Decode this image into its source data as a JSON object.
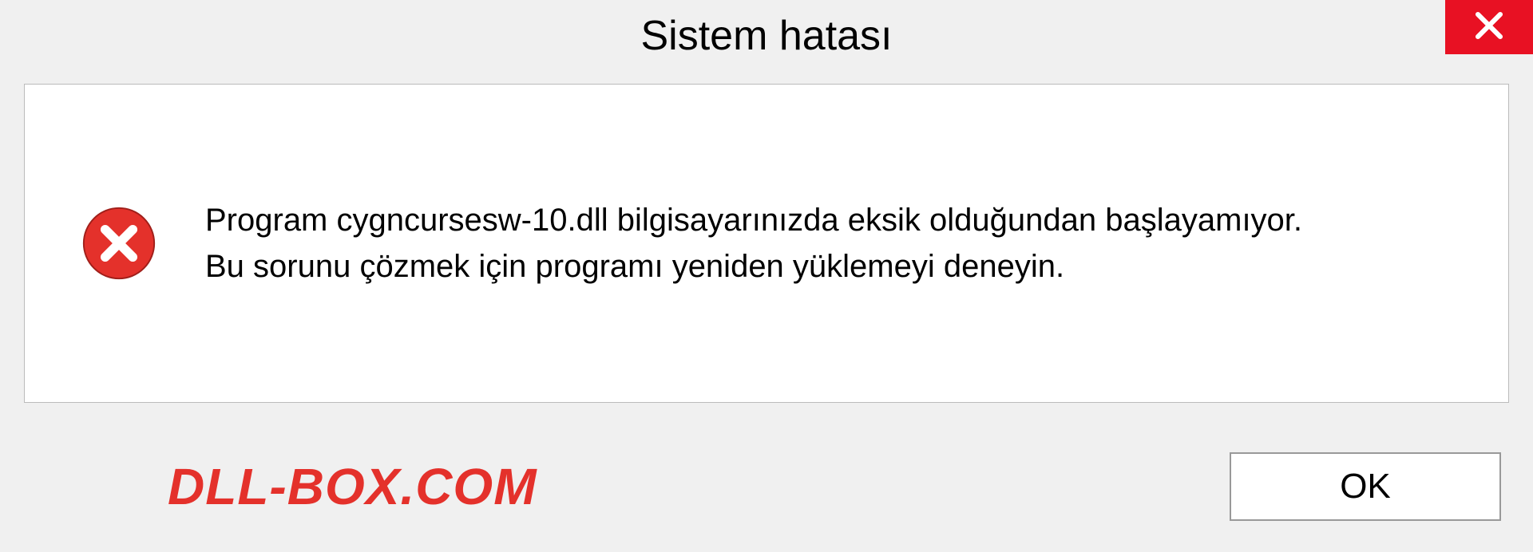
{
  "titlebar": {
    "title": "Sistem hatası"
  },
  "message": {
    "line1": "Program cygncursesw-10.dll bilgisayarınızda eksik olduğundan başlayamıyor.",
    "line2": "Bu sorunu çözmek için programı yeniden yüklemeyi deneyin."
  },
  "watermark": "DLL-BOX.COM",
  "buttons": {
    "ok": "OK"
  },
  "icons": {
    "close": "close-icon",
    "error": "error-icon"
  },
  "colors": {
    "close_bg": "#e81123",
    "error_red": "#e4312b",
    "watermark": "#e4312b"
  }
}
